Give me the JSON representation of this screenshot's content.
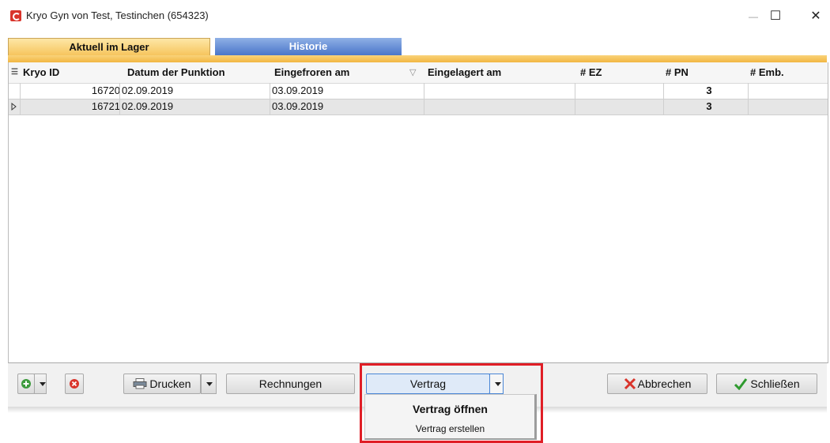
{
  "window": {
    "title": "Kryo Gyn von Test, Testinchen (654323)",
    "minimize_glyph": "—",
    "maximize_glyph": "☐",
    "close_glyph": "✕"
  },
  "tabs": [
    {
      "label": "Aktuell im Lager",
      "active": true
    },
    {
      "label": "Historie",
      "active": false
    }
  ],
  "table": {
    "columns": [
      "Kryo ID",
      "Datum der Punktion",
      "Eingefroren am",
      "Eingelagert am",
      "# EZ",
      "# PN",
      "# Emb."
    ],
    "sort_indicator": "▽",
    "rows": [
      {
        "kryo_id": "16720",
        "datum": "02.09.2019",
        "eingefroren": "03.09.2019",
        "eingelagert": "",
        "ez": "",
        "pn": "3",
        "emb": "",
        "selected": false
      },
      {
        "kryo_id": "16721",
        "datum": "02.09.2019",
        "eingefroren": "03.09.2019",
        "eingelagert": "",
        "ez": "",
        "pn": "3",
        "emb": "",
        "selected": true
      }
    ]
  },
  "buttons": {
    "drucken": "Drucken",
    "rechnungen": "Rechnungen",
    "vertrag": "Vertrag",
    "abbrechen": "Abbrechen",
    "schliessen": "Schließen"
  },
  "vertrag_menu": {
    "items": [
      "Vertrag öffnen",
      "Vertrag erstellen"
    ]
  },
  "colors": {
    "active_tab": "#f6c35a",
    "inactive_tab": "#4a76c9",
    "highlight_box": "#e01e26",
    "add_icon": "#3c9a3c",
    "delete_icon": "#d9342b",
    "check_icon": "#2e9a2e",
    "cancel_icon": "#d9342b"
  }
}
